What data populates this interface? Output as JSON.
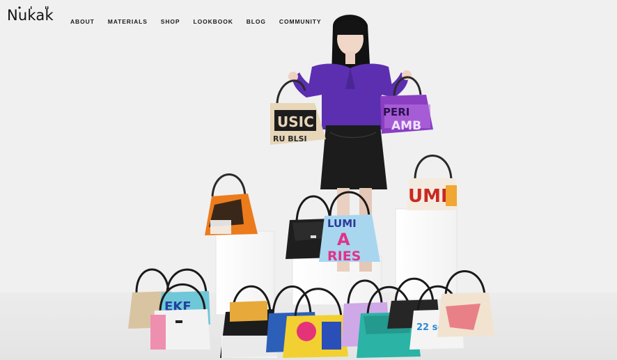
{
  "brand": {
    "logo_text": "Nukak"
  },
  "nav": {
    "items": [
      {
        "id": "about",
        "label": "ABOUT"
      },
      {
        "id": "materials",
        "label": "MATERIALS"
      },
      {
        "id": "shop",
        "label": "SHOP"
      },
      {
        "id": "lookbook",
        "label": "LOOKBOOK"
      },
      {
        "id": "blog",
        "label": "BLOG"
      },
      {
        "id": "community",
        "label": "COMMUNITY"
      }
    ]
  },
  "hero": {
    "bag_prints": {
      "left_hand": [
        "USIC",
        "RU BLSI"
      ],
      "right_hand": [
        "PERI",
        "AMB"
      ],
      "right_pedestal": [
        "UMI"
      ],
      "center_light_blue": [
        "LUMI",
        "A",
        "RIES"
      ],
      "front_left": [
        "EKF"
      ],
      "front_blue": [
        "22 se s"
      ]
    },
    "colors": {
      "background": "#f0f0f0",
      "sweater": "#5b2fb0",
      "skirt": "#1c1c1c",
      "pedestal": "#fbfbfb"
    }
  }
}
